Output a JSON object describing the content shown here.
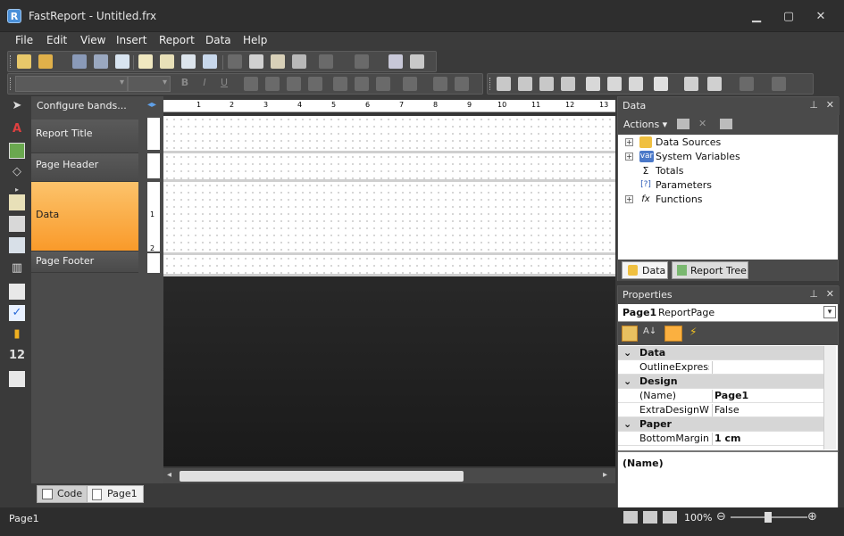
{
  "window": {
    "title": "FastReport - Untitled.frx",
    "logo": "R",
    "minimize": "▁",
    "maximize": "▢",
    "close": "✕"
  },
  "menu": [
    "File",
    "Edit",
    "View",
    "Insert",
    "Report",
    "Data",
    "Help"
  ],
  "band_panel": {
    "configure": "Configure bands...",
    "bands": [
      {
        "label": "Report Title",
        "selected": false
      },
      {
        "label": "Page Header",
        "selected": false
      },
      {
        "label": "Data",
        "selected": true
      },
      {
        "label": "Page Footer",
        "selected": false
      }
    ]
  },
  "ruler": {
    "ticks": [
      "1",
      "2",
      "3",
      "4",
      "5",
      "6",
      "7",
      "8",
      "9",
      "10",
      "11",
      "12",
      "13"
    ],
    "vticks": [
      "1",
      "2"
    ]
  },
  "tabs": {
    "code": "Code",
    "page": "Page1"
  },
  "status": {
    "left": "Page1",
    "zoom": "100%"
  },
  "data_panel": {
    "title": "Data",
    "actions": "Actions",
    "tree": [
      {
        "label": "Data Sources",
        "icon": "database-icon",
        "expandable": true
      },
      {
        "label": "System Variables",
        "icon": "var-icon",
        "expandable": true,
        "badge": "var"
      },
      {
        "label": "Totals",
        "icon": "sigma-icon",
        "expandable": false,
        "glyph": "Σ"
      },
      {
        "label": "Parameters",
        "icon": "parameters-icon",
        "expandable": false,
        "glyph": "[?]"
      },
      {
        "label": "Functions",
        "icon": "function-icon",
        "expandable": true,
        "glyph": "fx"
      }
    ],
    "tab_data": "Data",
    "tab_tree": "Report Tree"
  },
  "properties": {
    "title": "Properties",
    "object_name": "Page1",
    "object_type": "ReportPage",
    "rows": [
      {
        "cat": "Data"
      },
      {
        "name": "OutlineExpressio",
        "value": ""
      },
      {
        "cat": "Design"
      },
      {
        "name": "(Name)",
        "value": "Page1",
        "bold": true
      },
      {
        "name": "ExtraDesignWid",
        "value": "False"
      },
      {
        "cat": "Paper"
      },
      {
        "name": "BottomMargin",
        "value": "1 cm",
        "bold": true
      }
    ],
    "description": "(Name)"
  },
  "colors": {
    "accent": "#f99a2a",
    "dark": "#3a3a3a"
  }
}
